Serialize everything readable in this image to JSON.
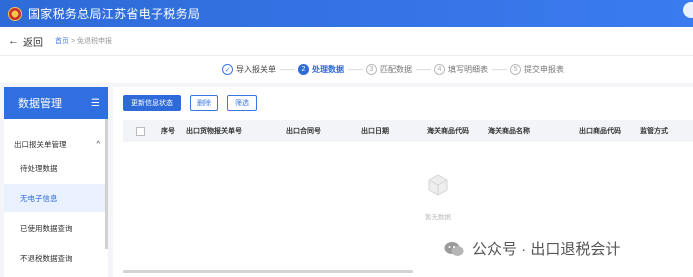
{
  "header": {
    "title": "国家税务总局江苏省电子税务局"
  },
  "nav": {
    "back_label": "返回",
    "back_arrow": "←",
    "breadcrumb_home": "首页",
    "breadcrumb_sep": ">",
    "breadcrumb_current": "免退税申报"
  },
  "steps": [
    {
      "num": "✓",
      "label": "导入报关单",
      "state": "done"
    },
    {
      "num": "2",
      "label": "处理数据",
      "state": "active"
    },
    {
      "num": "3",
      "label": "匹配数据",
      "state": "todo"
    },
    {
      "num": "4",
      "label": "填写明细表",
      "state": "todo"
    },
    {
      "num": "5",
      "label": "提交申报表",
      "state": "todo"
    }
  ],
  "sidebar": {
    "title": "数据管理",
    "menu_icon": "menu-icon",
    "group_label": "出口报关单管理",
    "group_chevron": "^",
    "items": [
      {
        "label": "待处理数据"
      },
      {
        "label": "无电子信息"
      },
      {
        "label": "已使用数据查询"
      },
      {
        "label": "不退税数据查询"
      }
    ]
  },
  "toolbar": {
    "update_label": "更新信息状态",
    "delete_label": "删除",
    "filter_label": "筛选"
  },
  "table": {
    "columns": [
      "序号",
      "出口货物报关单号",
      "出口合同号",
      "出口日期",
      "海关商品代码",
      "海关商品名称",
      "出口商品代码",
      "监管方式"
    ],
    "empty_text": "暂无数据"
  },
  "watermark": {
    "text": "公众号 · 出口退税会计"
  },
  "colors": {
    "brand": "#2e6bd8",
    "header_bg": "#3a7bf0"
  }
}
